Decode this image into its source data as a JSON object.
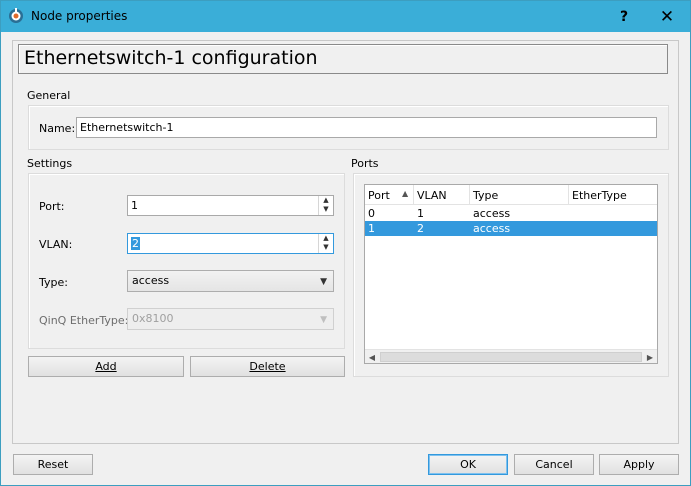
{
  "window": {
    "title": "Node properties",
    "help_glyph": "?",
    "close_glyph": "✕"
  },
  "header": {
    "title": "Ethernetswitch-1 configuration"
  },
  "general": {
    "label": "General",
    "name_label": "Name:",
    "name_value": "Ethernetswitch-1"
  },
  "settings": {
    "label": "Settings",
    "port_label": "Port:",
    "port_value": "1",
    "vlan_label": "VLAN:",
    "vlan_value": "2",
    "type_label": "Type:",
    "type_value": "access",
    "qinq_label": "QinQ EtherType:",
    "qinq_value": "0x8100",
    "add_label": "Add",
    "delete_label": "Delete"
  },
  "ports": {
    "label": "Ports",
    "columns": [
      "Port",
      "VLAN",
      "Type",
      "EtherType"
    ],
    "rows": [
      {
        "port": "0",
        "vlan": "1",
        "type": "access",
        "ethertype": ""
      },
      {
        "port": "1",
        "vlan": "2",
        "type": "access",
        "ethertype": ""
      }
    ],
    "selected_row": 1
  },
  "footer": {
    "reset_label": "Reset",
    "ok_label": "OK",
    "cancel_label": "Cancel",
    "apply_label": "Apply"
  },
  "colors": {
    "titlebar": "#3aaed8",
    "selection": "#3399dd"
  }
}
